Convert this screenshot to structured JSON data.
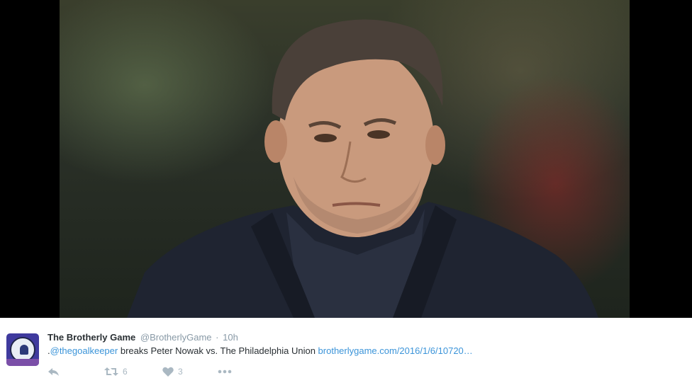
{
  "tweet": {
    "display_name": "The Brotherly Game",
    "handle": "@BrotherlyGame",
    "separator": "·",
    "time": "10h",
    "text_prefix": ".",
    "mention": "@thegoalkeeper",
    "text_body": " breaks Peter Nowak vs. The Philadelphia Union ",
    "link": "brotherlygame.com/2016/1/6/10720…",
    "retweet_count": "6",
    "like_count": "3"
  },
  "colors": {
    "link": "#3b94d9",
    "secondary_text": "#8899a6",
    "primary_text": "#292f33",
    "action_icon": "#aab8c2",
    "media_background": "#000000"
  },
  "icons": {
    "reply": "reply-icon",
    "retweet": "retweet-icon",
    "like": "heart-icon",
    "more": "more-icon"
  }
}
